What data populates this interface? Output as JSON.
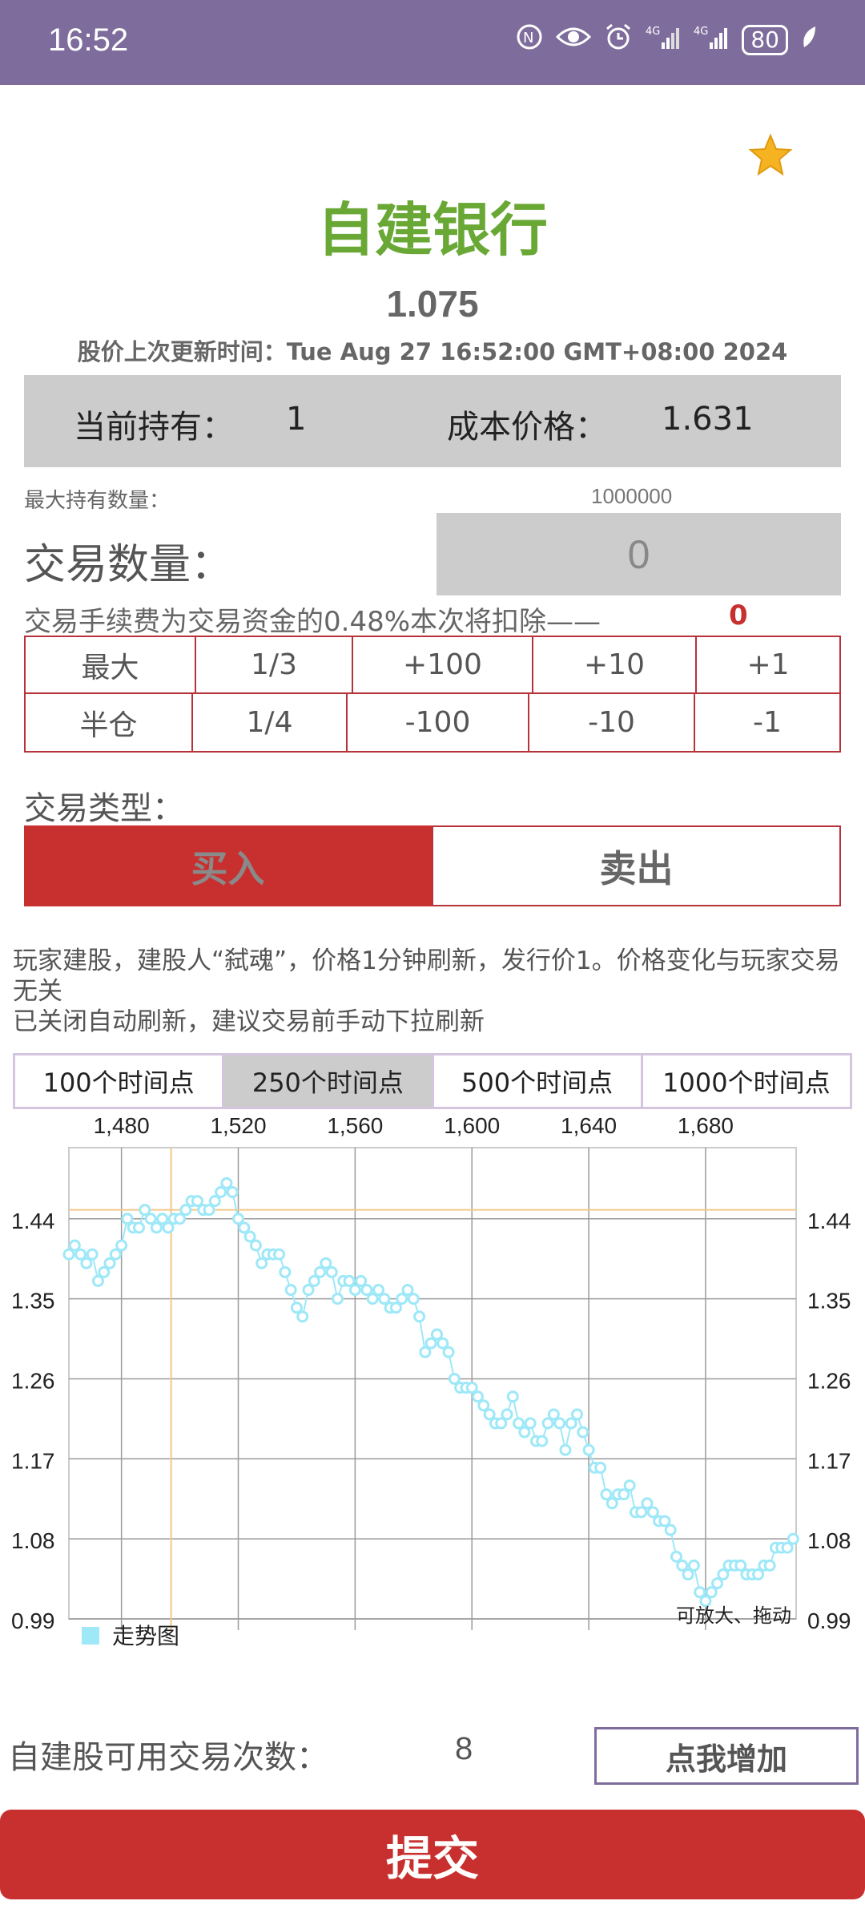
{
  "status_bar": {
    "time": "16:52",
    "network1": "4G",
    "network2": "4G",
    "battery": "80"
  },
  "stock": {
    "name": "自建银行",
    "price": "1.075",
    "update_time": "股价上次更新时间：Tue Aug 27 16:52:00 GMT+08:00 2024",
    "favorite_icon": "star-icon"
  },
  "holding": {
    "hold_label": "当前持有：",
    "hold_value": "1",
    "cost_label": "成本价格：",
    "cost_value": "1.631"
  },
  "limits": {
    "max_label": "最大持有数量：",
    "max_value": "1000000"
  },
  "quantity": {
    "label": "交易数量：",
    "value": "0"
  },
  "fee": {
    "text": "交易手续费为交易资金的0.48%本次将扣除——",
    "value": "0"
  },
  "quick_buttons": {
    "row1": [
      "最大",
      "1/3",
      "+100",
      "+10",
      "+1"
    ],
    "row2": [
      "半仓",
      "1/4",
      "-100",
      "-10",
      "-1"
    ]
  },
  "trade_type": {
    "label": "交易类型：",
    "buy": "买入",
    "sell": "卖出",
    "selected": "买入"
  },
  "description": {
    "line1": "玩家建股，建股人“弑魂”，价格1分钟刷新，发行价1。价格变化与玩家交易无关",
    "line2": "已关闭自动刷新，建议交易前手动下拉刷新"
  },
  "range_tabs": [
    "100个时间点",
    "250个时间点",
    "500个时间点",
    "1000个时间点"
  ],
  "range_selected": 1,
  "chart_data": {
    "type": "line",
    "x_ticks": [
      "1,480",
      "1,520",
      "1,560",
      "1,600",
      "1,640",
      "1,680"
    ],
    "y_ticks": [
      "1.44",
      "1.35",
      "1.26",
      "1.17",
      "1.08",
      "0.99"
    ],
    "xlim": [
      1462,
      1711
    ],
    "ylim": [
      0.99,
      1.52
    ],
    "legend": "走势图",
    "note": "可放大、拖动",
    "series": [
      {
        "name": "走势图",
        "color": "#9ee8f8",
        "x": [
          1462,
          1464,
          1466,
          1468,
          1470,
          1472,
          1474,
          1476,
          1478,
          1480,
          1482,
          1484,
          1486,
          1488,
          1490,
          1492,
          1494,
          1496,
          1498,
          1500,
          1502,
          1504,
          1506,
          1508,
          1510,
          1512,
          1514,
          1516,
          1518,
          1520,
          1522,
          1524,
          1526,
          1528,
          1530,
          1532,
          1534,
          1536,
          1538,
          1540,
          1542,
          1544,
          1546,
          1548,
          1550,
          1552,
          1554,
          1556,
          1558,
          1560,
          1562,
          1564,
          1566,
          1568,
          1570,
          1572,
          1574,
          1576,
          1578,
          1580,
          1582,
          1584,
          1586,
          1588,
          1590,
          1592,
          1594,
          1596,
          1598,
          1600,
          1602,
          1604,
          1606,
          1608,
          1610,
          1612,
          1614,
          1616,
          1618,
          1620,
          1622,
          1624,
          1626,
          1628,
          1630,
          1632,
          1634,
          1636,
          1638,
          1640,
          1642,
          1644,
          1646,
          1648,
          1650,
          1652,
          1654,
          1656,
          1658,
          1660,
          1662,
          1664,
          1666,
          1668,
          1670,
          1672,
          1674,
          1676,
          1678,
          1680,
          1682,
          1684,
          1686,
          1688,
          1690,
          1692,
          1694,
          1696,
          1698,
          1700,
          1702,
          1704,
          1706,
          1708,
          1710
        ],
        "y": [
          1.4,
          1.41,
          1.4,
          1.39,
          1.4,
          1.37,
          1.38,
          1.39,
          1.4,
          1.41,
          1.44,
          1.43,
          1.43,
          1.45,
          1.44,
          1.43,
          1.44,
          1.43,
          1.44,
          1.44,
          1.45,
          1.46,
          1.46,
          1.45,
          1.45,
          1.46,
          1.47,
          1.48,
          1.47,
          1.44,
          1.43,
          1.42,
          1.41,
          1.39,
          1.4,
          1.4,
          1.4,
          1.38,
          1.36,
          1.34,
          1.33,
          1.36,
          1.37,
          1.38,
          1.39,
          1.38,
          1.35,
          1.37,
          1.37,
          1.36,
          1.37,
          1.36,
          1.35,
          1.36,
          1.35,
          1.34,
          1.34,
          1.35,
          1.36,
          1.35,
          1.33,
          1.29,
          1.3,
          1.31,
          1.3,
          1.29,
          1.26,
          1.25,
          1.25,
          1.25,
          1.24,
          1.23,
          1.22,
          1.21,
          1.21,
          1.22,
          1.24,
          1.21,
          1.2,
          1.21,
          1.19,
          1.19,
          1.21,
          1.22,
          1.21,
          1.18,
          1.21,
          1.22,
          1.2,
          1.18,
          1.16,
          1.16,
          1.13,
          1.12,
          1.13,
          1.13,
          1.14,
          1.11,
          1.11,
          1.12,
          1.11,
          1.1,
          1.1,
          1.09,
          1.06,
          1.05,
          1.04,
          1.05,
          1.02,
          1.01,
          1.02,
          1.03,
          1.04,
          1.05,
          1.05,
          1.05,
          1.04,
          1.04,
          1.04,
          1.05,
          1.05,
          1.07,
          1.07,
          1.07,
          1.08
        ]
      }
    ]
  },
  "trades_available": {
    "label": "自建股可用交易次数：",
    "value": "8",
    "add_button": "点我增加"
  },
  "submit": {
    "label": "提交"
  }
}
